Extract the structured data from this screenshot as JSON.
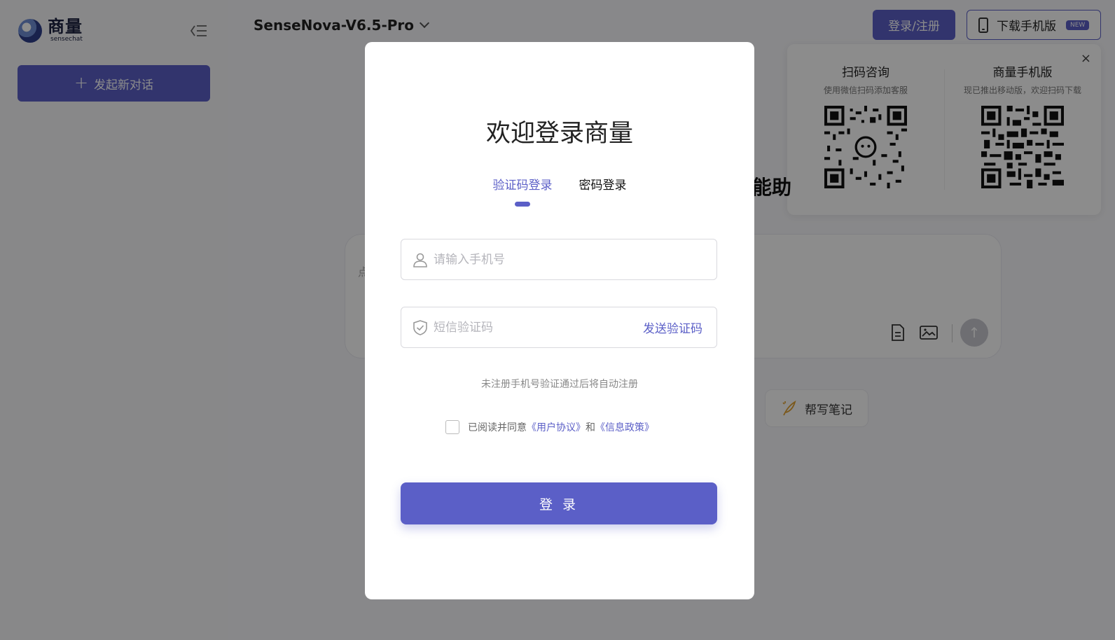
{
  "sidebar": {
    "logo_title": "商量",
    "logo_sub": "sensechat",
    "new_chat_label": "发起新对话"
  },
  "header": {
    "model_name": "SenseNova-V6.5-Pro",
    "login_label": "登录/注册",
    "download_label": "下载手机版",
    "new_badge": "NEW"
  },
  "qr_popover": {
    "left_title": "扫码咨询",
    "left_sub": "使用微信扫码添加客服",
    "right_title": "商量手机版",
    "right_sub": "现已推出移动版，欢迎扫码下载",
    "close_glyph": "×"
  },
  "main": {
    "hero_fragment": "能助",
    "input_fragment": "点",
    "send_glyph": "↑",
    "note_chip_label": "帮写笔记"
  },
  "login_modal": {
    "title": "欢迎登录商量",
    "tabs": [
      {
        "label": "验证码登录",
        "active": true
      },
      {
        "label": "密码登录",
        "active": false
      }
    ],
    "phone_placeholder": "请输入手机号",
    "code_placeholder": "短信验证码",
    "send_code_label": "发送验证码",
    "hint": "未注册手机号验证通过后将自动注册",
    "agree_prefix": "已阅读并同意",
    "user_agreement": "《用户协议》",
    "agree_and": "和",
    "privacy_policy": "《信息政策》",
    "login_label": "登 录"
  },
  "colors": {
    "accent": "#5b5fc7",
    "overlay": "rgba(0,0,0,0.45)"
  }
}
